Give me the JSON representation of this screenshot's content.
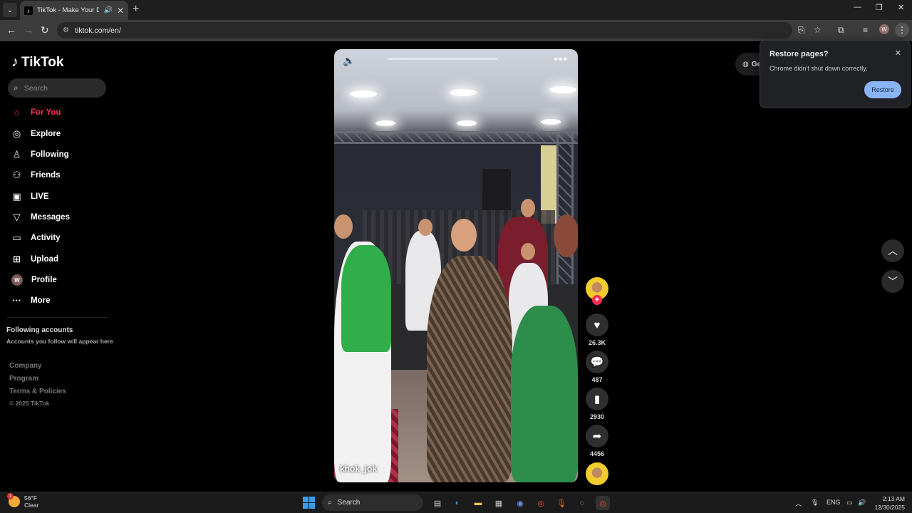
{
  "browser": {
    "tab_title": "TikTok - Make Your Day",
    "url": "tiktok.com/en/",
    "profile_initial": "W"
  },
  "sidebar": {
    "logo_text": "TikTok",
    "search_placeholder": "Search",
    "items": [
      {
        "label": "For You",
        "icon": "home-icon",
        "active": true
      },
      {
        "label": "Explore",
        "icon": "compass-icon"
      },
      {
        "label": "Following",
        "icon": "following-icon"
      },
      {
        "label": "Friends",
        "icon": "friends-icon"
      },
      {
        "label": "LIVE",
        "icon": "live-icon"
      },
      {
        "label": "Messages",
        "icon": "messages-icon"
      },
      {
        "label": "Activity",
        "icon": "activity-icon"
      },
      {
        "label": "Upload",
        "icon": "upload-icon"
      },
      {
        "label": "Profile",
        "icon": "avatar",
        "initial": "W"
      },
      {
        "label": "More",
        "icon": "more-icon"
      }
    ],
    "following_title": "Following accounts",
    "following_sub": "Accounts you follow will appear here",
    "footer": [
      "Company",
      "Program",
      "Terms & Policies"
    ],
    "copyright": "© 2025 TikTok"
  },
  "video": {
    "author": "khok_jok"
  },
  "actions": {
    "likes": "26.3K",
    "comments": "487",
    "saves": "2930",
    "shares": "4456"
  },
  "get_app": "Ge",
  "restore_popup": {
    "title": "Restore pages?",
    "message": "Chrome didn't shut down correctly.",
    "button": "Restore"
  },
  "taskbar": {
    "temperature": "56°F",
    "condition": "Clear",
    "weather_badge": "1",
    "search_label": "Search",
    "language": "ENG",
    "time": "2:13 AM",
    "date": "12/30/2025"
  }
}
